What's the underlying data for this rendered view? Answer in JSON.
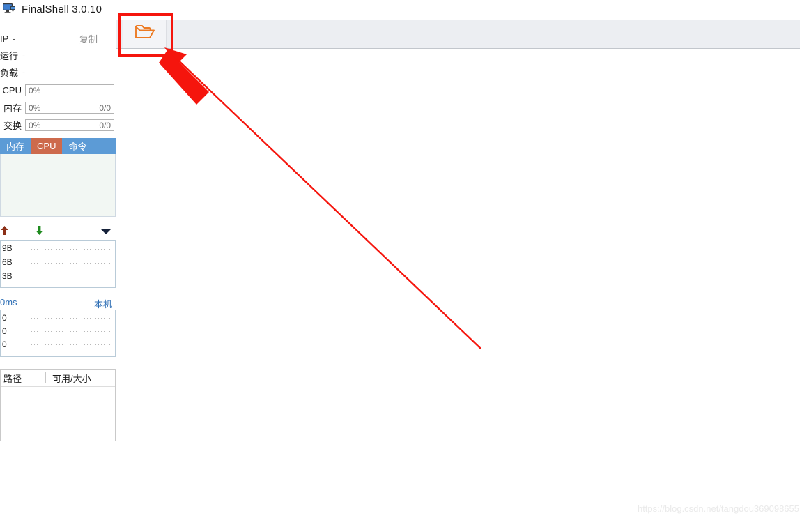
{
  "window": {
    "title": "FinalShell 3.0.10",
    "icon": "monitor-icon"
  },
  "sidebar": {
    "info_rows": [
      {
        "label": "IP",
        "value": "-"
      },
      {
        "label": "运行",
        "value": "-"
      },
      {
        "label": "负载",
        "value": "-"
      }
    ],
    "copy_label": "复制",
    "meters": [
      {
        "label": "CPU",
        "percent": "0%",
        "fraction": ""
      },
      {
        "label": "内存",
        "percent": "0%",
        "fraction": "0/0"
      },
      {
        "label": "交换",
        "percent": "0%",
        "fraction": "0/0"
      }
    ],
    "tabs": [
      {
        "label": "内存",
        "active": false
      },
      {
        "label": "CPU",
        "active": true
      },
      {
        "label": "命令",
        "active": false
      }
    ],
    "network": {
      "upload_icon": "upload-arrow-icon",
      "download_icon": "download-arrow-icon",
      "upload_rate": "",
      "download_rate": "",
      "caret_icon": "chevron-down-icon",
      "y_labels": [
        "9B",
        "6B",
        "3B"
      ]
    },
    "ping": {
      "latency": "0ms",
      "host": "本机",
      "y_labels": [
        "0",
        "0",
        "0"
      ]
    },
    "disk": {
      "columns": [
        "路径",
        "可用/大小"
      ],
      "rows": []
    }
  },
  "toolbar": {
    "buttons": [
      {
        "name": "open-folder-button",
        "icon": "open-folder-icon",
        "label": ""
      }
    ]
  },
  "annotations": {
    "highlight_color": "#f5150d",
    "arrow_color": "#f5150d",
    "target": "open-folder-button"
  },
  "watermark": {
    "text": "https://blog.csdn.net/tangdou369098655"
  },
  "colors": {
    "tab_bar": "#5c9bd6",
    "tab_active": "#cd6a4c",
    "toolbar_bg": "#eceef2",
    "folder_icon": "#ec7a23",
    "link_blue": "#2f6fb5"
  }
}
